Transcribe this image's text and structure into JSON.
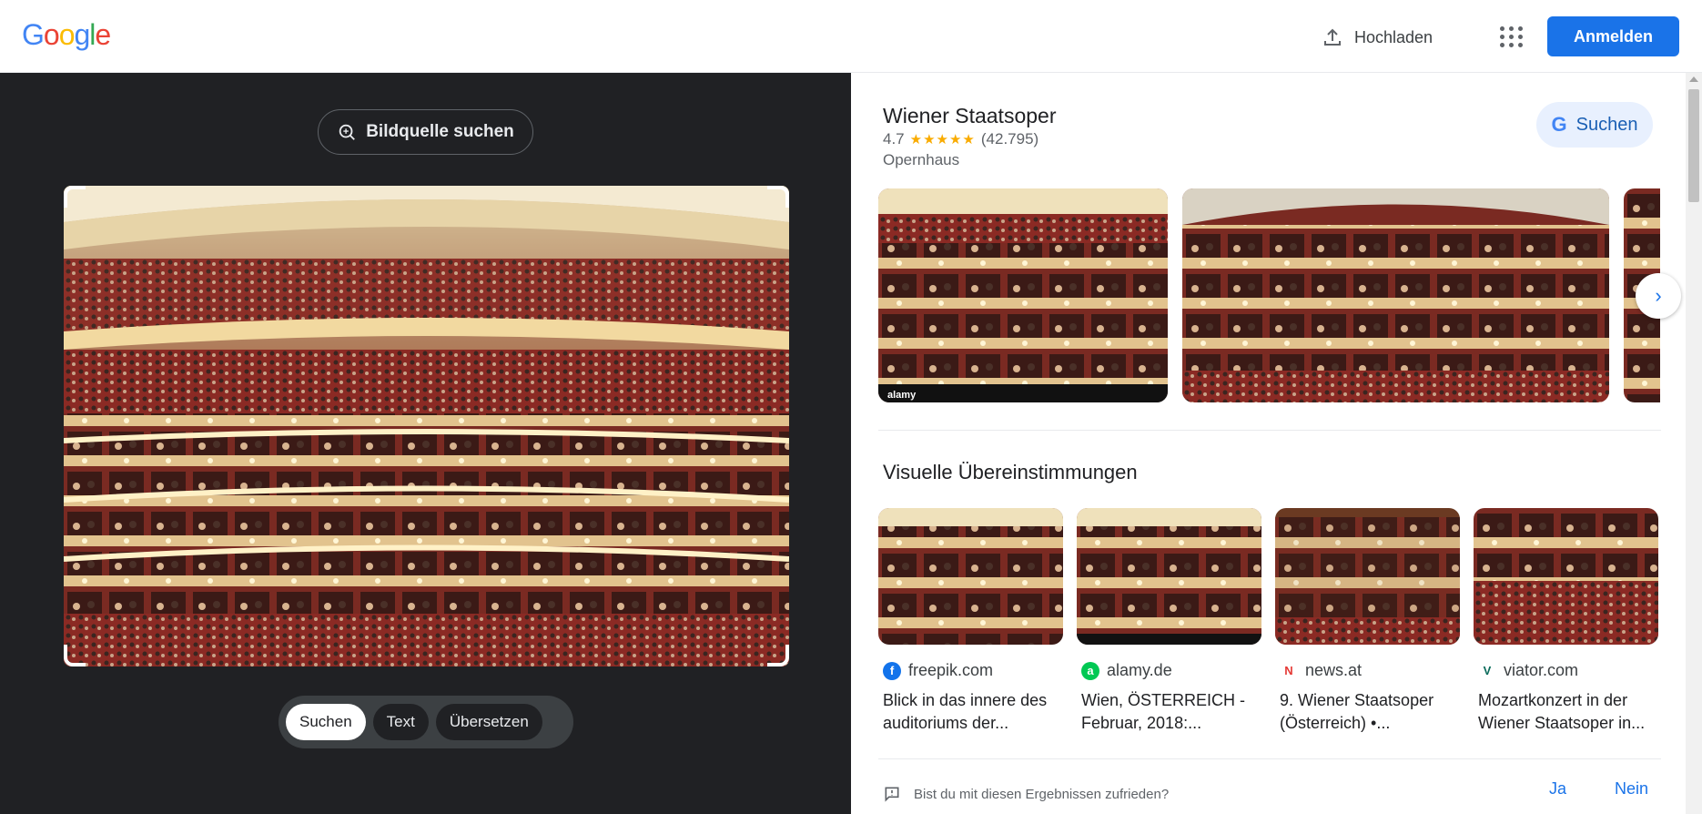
{
  "header": {
    "logo_letters": [
      "G",
      "o",
      "o",
      "g",
      "l",
      "e"
    ],
    "logo_colors": [
      "#4285f4",
      "#ea4335",
      "#fbbc05",
      "#4285f4",
      "#34a853",
      "#ea4335"
    ],
    "upload_label": "Hochladen",
    "signin_label": "Anmelden"
  },
  "left": {
    "source_button": "Bildquelle suchen",
    "modes": [
      "Suchen",
      "Text",
      "Übersetzen"
    ]
  },
  "knowledge_panel": {
    "title": "Wiener Staatsoper",
    "rating": "4.7",
    "stars": "★★★★★",
    "reviews": "(42.795)",
    "type": "Opernhaus",
    "search_button": "Suchen",
    "search_icon_letter": "G",
    "image_watermark": "alamy"
  },
  "visual_matches": {
    "title": "Visuelle Übereinstimmungen",
    "items": [
      {
        "source": "freepik.com",
        "favicon": "f",
        "favicon_color": "#1273eb",
        "desc_line1": "Blick in das innere des",
        "desc_line2": "auditoriums der..."
      },
      {
        "source": "alamy.de",
        "favicon": "a",
        "favicon_color": "#00c853",
        "desc_line1": "Wien, ÖSTERREICH -",
        "desc_line2": "Februar, 2018:..."
      },
      {
        "source": "news.at",
        "favicon": "N",
        "favicon_color": "#e53935",
        "desc_line1": "9. Wiener Staatsoper",
        "desc_line2": "(Österreich) •..."
      },
      {
        "source": "viator.com",
        "favicon": "V",
        "favicon_color": "#0a6b5b",
        "desc_line1": "Mozartkonzert in der",
        "desc_line2": "Wiener Staatsoper in..."
      }
    ]
  },
  "feedback": {
    "question": "Bist du mit diesen Ergebnissen zufrieden?",
    "yes": "Ja",
    "no": "Nein"
  },
  "colors": {
    "accent": "#1a73e8",
    "dark_bg": "#202124",
    "star": "#f9ab00"
  }
}
